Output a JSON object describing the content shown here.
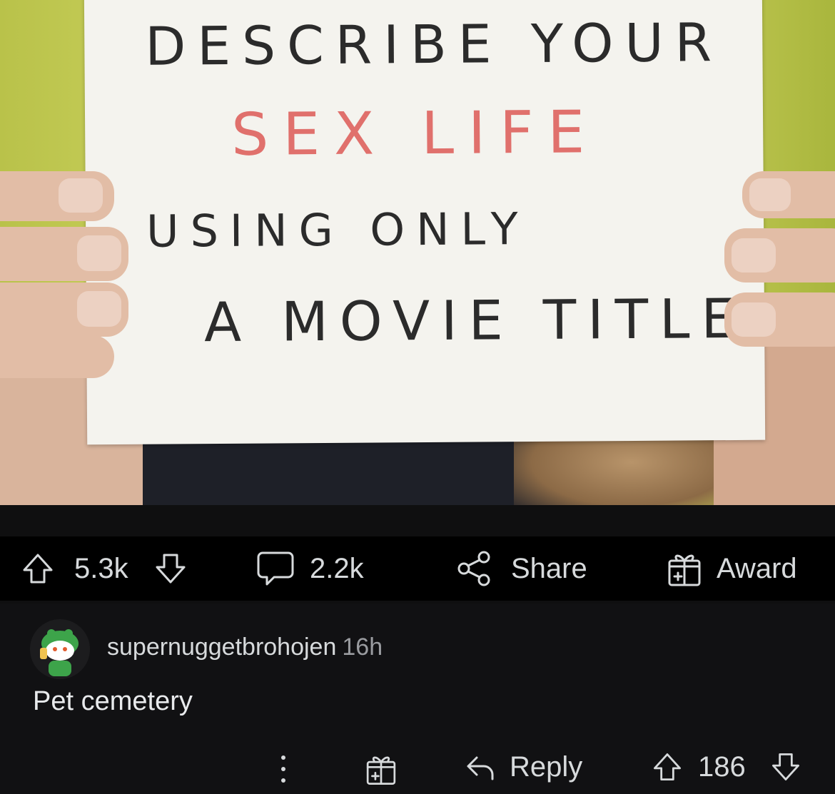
{
  "post": {
    "sign_text": {
      "line1": "DESCRIBE YOUR",
      "line2": "SEX LIFE",
      "line3": "USING ONLY",
      "line4": "A MOVIE TITLE"
    },
    "upvotes": "5.3k",
    "comments": "2.2k",
    "share_label": "Share",
    "award_label": "Award"
  },
  "comment": {
    "username": "supernuggetbrohojen",
    "age": "16h",
    "body": "Pet cemetery",
    "reply_label": "Reply",
    "score": "186"
  },
  "colors": {
    "background": "#0f0f10",
    "text": "#d7dadc",
    "sign_accent": "#e0706c",
    "photo_bg": "#c6cc58"
  },
  "icons": {
    "upvote": "arrow-up-icon",
    "downvote": "arrow-down-icon",
    "comment": "speech-bubble-icon",
    "share": "share-icon",
    "award": "gift-icon",
    "more": "vertical-dots-icon",
    "reply": "reply-arrow-icon"
  }
}
